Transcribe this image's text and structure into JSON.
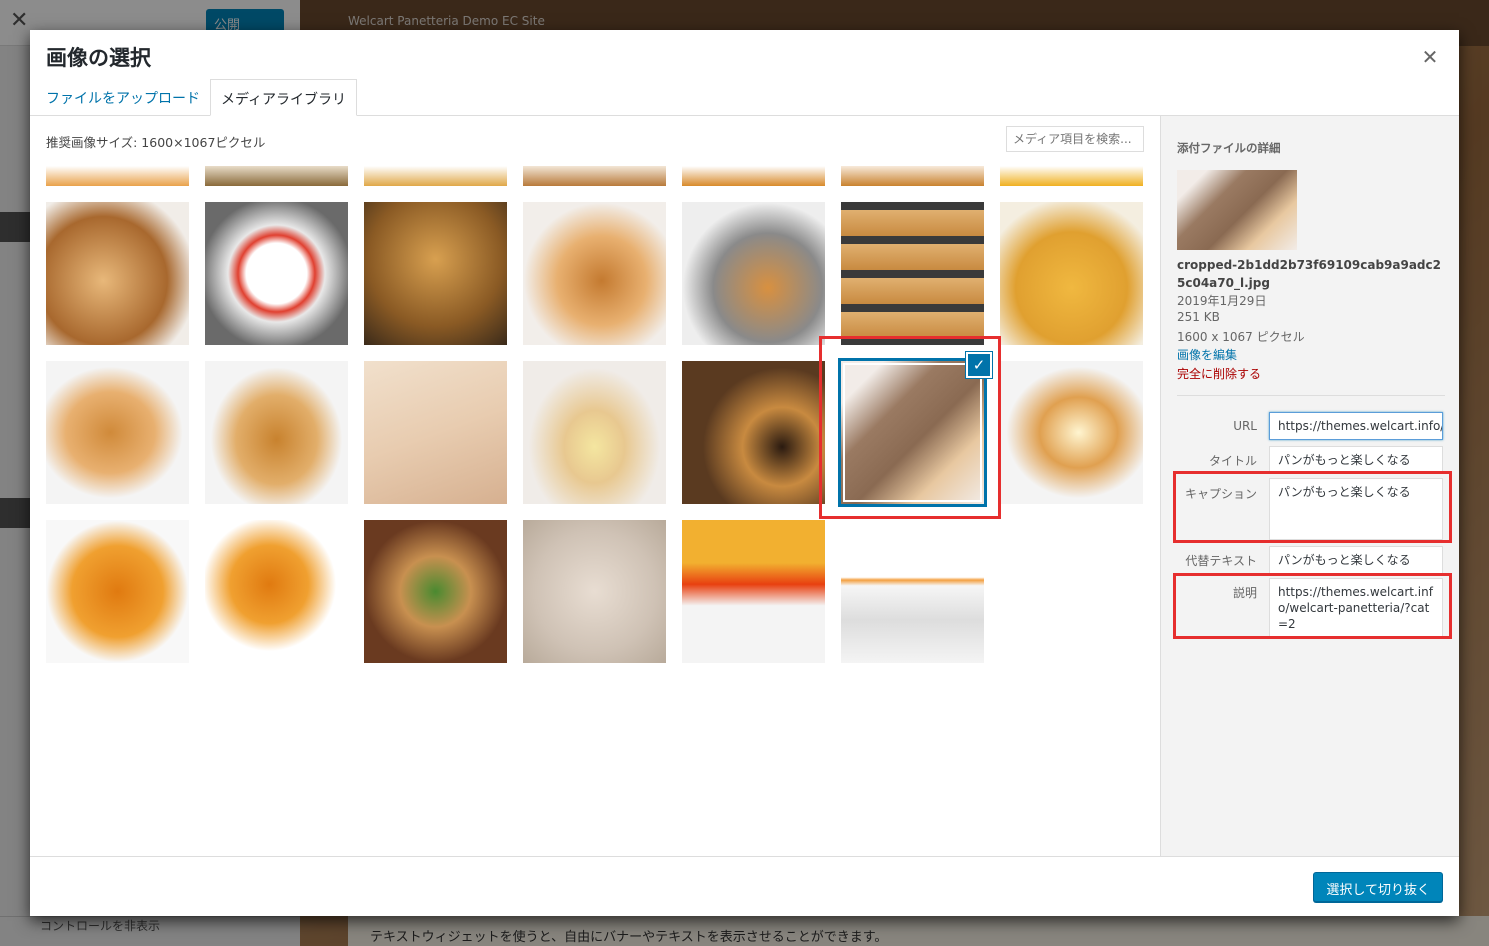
{
  "background": {
    "publish_label": "公開",
    "site_title": "Welcart Panetteria Demo EC Site",
    "hide_controls": "コントロールを非表示",
    "footer_text": "テキストウィジェットを使うと、自由にバナーやテキストを表示させることができます。"
  },
  "modal": {
    "title": "画像の選択",
    "close_icon": "close-icon",
    "tabs": [
      {
        "label": "ファイルをアップロード"
      },
      {
        "label": "メディアライブラリ"
      }
    ],
    "recommended_size": "推奨画像サイズ: 1600×1067ピクセル",
    "search_placeholder": "メディア項目を検索..."
  },
  "grid": {
    "rows": [
      [
        "croissant-partial",
        "bread-partial",
        "roll-partial",
        "bread-partial",
        "bun-partial",
        "bread-partial",
        "croissant-partial"
      ],
      [
        "croissant",
        "breakfast-plate",
        "bakery-croissants",
        "croissant-plate",
        "croissant-tray",
        "baking-trays",
        "croissant-basket"
      ],
      [
        "cone-bread",
        "turnover",
        "dough-rolling",
        "cream-cones",
        "breakfast-table",
        "sliced-bread",
        "cream-roll"
      ],
      [
        "croissant-white",
        "croissant-plate-white",
        "sandwich",
        "dough-balls",
        "campaign-banner",
        "site-screenshot"
      ]
    ],
    "selected": "sliced-bread",
    "colors": {
      "selected_outline": "#0073aa",
      "annotation_red": "#e62e2e"
    }
  },
  "sidebar": {
    "heading": "添付ファイルの詳細",
    "filename": "cropped-2b1dd2b73f69109cab9a9adc25c04a70_l.jpg",
    "date": "2019年1月29日",
    "filesize": "251 KB",
    "dimensions": "1600 x 1067 ピクセル",
    "edit_link": "画像を編集",
    "delete_link": "完全に削除する",
    "fields": {
      "url_label": "URL",
      "url_value": "https://themes.welcart.info/",
      "title_label": "タイトル",
      "title_value": "パンがもっと楽しくなる",
      "caption_label": "キャプション",
      "caption_value": "パンがもっと楽しくなる",
      "alt_label": "代替テキスト",
      "alt_value": "パンがもっと楽しくなる",
      "desc_label": "説明",
      "desc_value": "https://themes.welcart.info/welcart-panetteria/?cat=2"
    }
  },
  "footer": {
    "primary_button": "選択して切り抜く"
  }
}
